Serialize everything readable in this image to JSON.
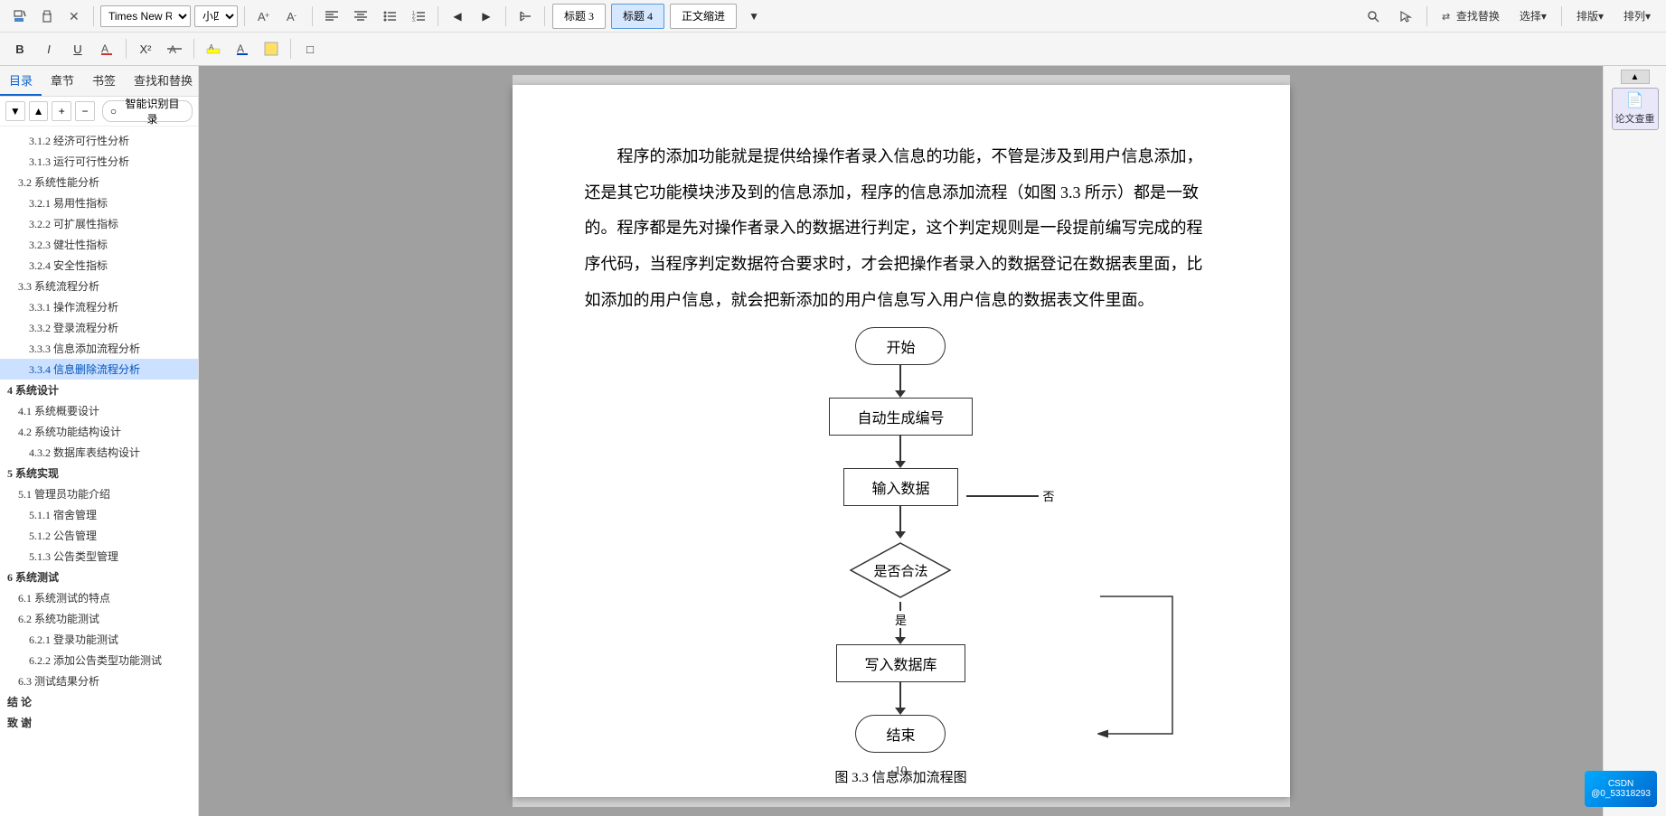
{
  "toolbar": {
    "font_name": "Times New Roma",
    "font_size": "小四",
    "buttons_row1": [
      "format",
      "paste",
      "clear",
      "font_increase",
      "font_decrease",
      "font_color",
      "erase",
      "list_ul",
      "list_ol",
      "indent_left",
      "indent_right",
      "align_left2",
      "align_center2",
      "justify",
      "line_spacing",
      "subscript",
      "columns",
      "border"
    ],
    "style_tabs": [
      "标题 3",
      "标题 4",
      "正文缩进"
    ],
    "search_btn": "查找替换",
    "select_btn": "选择▾",
    "layout_btn": "排版▾",
    "sort_btn": "排列▾",
    "row2_btns": [
      "bold",
      "italic",
      "underline",
      "font_color2",
      "superscript",
      "char_shading",
      "highlight",
      "border2"
    ],
    "bold_label": "B",
    "italic_label": "I",
    "underline_label": "U"
  },
  "sidebar": {
    "tabs": [
      "目录",
      "章节",
      "书签",
      "查找和替换"
    ],
    "active_tab": "目录",
    "controls": [
      "down",
      "up",
      "add",
      "minus"
    ],
    "smart_btn": "智能识别目录",
    "toc_items": [
      {
        "level": 3,
        "text": "3.1.2  经济可行性分析",
        "active": false
      },
      {
        "level": 3,
        "text": "3.1.3  运行可行性分析",
        "active": false
      },
      {
        "level": 2,
        "text": "3.2  系统性能分析",
        "active": false
      },
      {
        "level": 3,
        "text": "3.2.1  易用性指标",
        "active": false
      },
      {
        "level": 3,
        "text": "3.2.2  可扩展性指标",
        "active": false
      },
      {
        "level": 3,
        "text": "3.2.3  健壮性指标",
        "active": false
      },
      {
        "level": 3,
        "text": "3.2.4  安全性指标",
        "active": false
      },
      {
        "level": 2,
        "text": "3.3  系统流程分析",
        "active": false
      },
      {
        "level": 3,
        "text": "3.3.1  操作流程分析",
        "active": false
      },
      {
        "level": 3,
        "text": "3.3.2  登录流程分析",
        "active": false
      },
      {
        "level": 3,
        "text": "3.3.3  信息添加流程分析",
        "active": false
      },
      {
        "level": 3,
        "text": "3.3.4  信息删除流程分析",
        "active": true
      },
      {
        "level": 1,
        "text": "4  系统设计",
        "active": false
      },
      {
        "level": 2,
        "text": "4.1  系统概要设计",
        "active": false
      },
      {
        "level": 2,
        "text": "4.2  系统功能结构设计",
        "active": false
      },
      {
        "level": 3,
        "text": "4.3.2  数据库表结构设计",
        "active": false
      },
      {
        "level": 1,
        "text": "5  系统实现",
        "active": false
      },
      {
        "level": 2,
        "text": "5.1  管理员功能介绍",
        "active": false
      },
      {
        "level": 3,
        "text": "5.1.1  宿舍管理",
        "active": false
      },
      {
        "level": 3,
        "text": "5.1.2  公告管理",
        "active": false
      },
      {
        "level": 3,
        "text": "5.1.3  公告类型管理",
        "active": false
      },
      {
        "level": 1,
        "text": "6  系统测试",
        "active": false
      },
      {
        "level": 2,
        "text": "6.1  系统测试的特点",
        "active": false
      },
      {
        "level": 2,
        "text": "6.2  系统功能测试",
        "active": false
      },
      {
        "level": 3,
        "text": "6.2.1  登录功能测试",
        "active": false
      },
      {
        "level": 3,
        "text": "6.2.2  添加公告类型功能测试",
        "active": false
      },
      {
        "level": 2,
        "text": "6.3  测试结果分析",
        "active": false
      },
      {
        "level": 1,
        "text": "结  论",
        "active": false
      },
      {
        "level": 1,
        "text": "致  谢",
        "active": false
      }
    ]
  },
  "document": {
    "content": "程序的添加功能就是提供给操作者录入信息的功能，不管是涉及到用户信息添加，还是其它功能模块涉及到的信息添加，程序的信息添加流程（如图 3.3 所示）都是一致的。程序都是先对操作者录入的数据进行判定，这个判定规则是一段提前编写完成的程序代码，当程序判定数据符合要求时，才会把操作者录入的数据登记在数据表里面，比如添加的用户信息，就会把新添加的用户信息写入用户信息的数据表文件里面。",
    "flowchart": {
      "nodes": [
        {
          "id": "start",
          "type": "oval",
          "label": "开始"
        },
        {
          "id": "auto_gen",
          "type": "rect",
          "label": "自动生成编号"
        },
        {
          "id": "input_data",
          "type": "rect",
          "label": "输入数据"
        },
        {
          "id": "is_valid",
          "type": "diamond",
          "label": "是否合法"
        },
        {
          "id": "write_db",
          "type": "rect",
          "label": "写入数据库"
        },
        {
          "id": "end",
          "type": "oval",
          "label": "结束"
        }
      ],
      "labels": {
        "yes": "是",
        "no": "否"
      },
      "caption": "图 3.3   信息添加流程图"
    },
    "page_number": "10"
  },
  "right_panel": {
    "scroll_up": "▲",
    "scroll_down": "▼",
    "btn_label": "论文查重",
    "btn_icon": "📄"
  },
  "csdn": {
    "label": "CSDN @0_53318293"
  }
}
